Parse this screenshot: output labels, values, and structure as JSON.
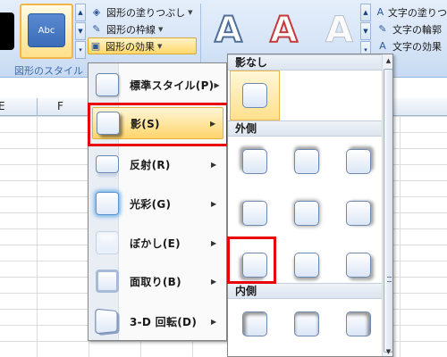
{
  "ribbon": {
    "styles_group_label": "図形のスタイル",
    "style_swatch_text": "Abc",
    "shape_commands": [
      {
        "label": "図形の塗りつぶし",
        "icon": "paint-bucket-icon"
      },
      {
        "label": "図形の枠線",
        "icon": "pencil-outline-icon"
      },
      {
        "label": "図形の効果",
        "icon": "shape-effects-icon"
      }
    ],
    "wordart_letter": "A",
    "text_commands": [
      {
        "label": "文字の塗りつ",
        "icon": "text-fill-icon"
      },
      {
        "label": "文字の輪郭",
        "icon": "text-outline-icon"
      },
      {
        "label": "文字の効果",
        "icon": "text-effects-icon"
      }
    ]
  },
  "sheet": {
    "columns": [
      "E",
      "F"
    ]
  },
  "effects_menu": {
    "items": [
      {
        "label": "標準スタイル(P)",
        "style": "default"
      },
      {
        "label": "影(S)",
        "style": "shadow"
      },
      {
        "label": "反射(R)",
        "style": "reflect"
      },
      {
        "label": "光彩(G)",
        "style": "glow"
      },
      {
        "label": "ぼかし(E)",
        "style": "soft"
      },
      {
        "label": "面取り(B)",
        "style": "bevel"
      },
      {
        "label": "3-D 回転(D)",
        "style": "3d"
      }
    ],
    "highlighted_index": 1
  },
  "shadow_gallery": {
    "sections": [
      {
        "heading": "影なし",
        "rows": 1,
        "cols": 1
      },
      {
        "heading": "外側",
        "rows": 3,
        "cols": 3
      },
      {
        "heading": "内側",
        "rows": 1,
        "cols": 3
      }
    ],
    "selected_outer_index": 6
  }
}
